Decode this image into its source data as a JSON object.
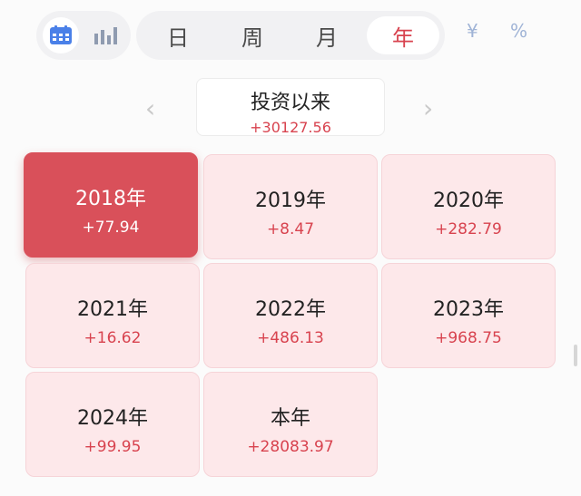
{
  "toolbar": {
    "views": [
      {
        "icon": "calendar-icon",
        "active": true
      },
      {
        "icon": "bar-chart-icon",
        "active": false
      }
    ],
    "periods": [
      "日",
      "周",
      "月",
      "年"
    ],
    "active_period": "年",
    "units": [
      "¥",
      "%"
    ],
    "colors": {
      "accent": "#d8434f",
      "icon_blue": "#4a80e8",
      "unit_blue": "#9fb3d6"
    }
  },
  "header": {
    "prev_arrow": "‹",
    "next_arrow": "›",
    "title": "投资以来",
    "value": "+30127.56"
  },
  "grid": {
    "cells": [
      {
        "label": "2018年",
        "value": "+77.94",
        "active": true
      },
      {
        "label": "2019年",
        "value": "+8.47",
        "active": false
      },
      {
        "label": "2020年",
        "value": "+282.79",
        "active": false
      },
      {
        "label": "2021年",
        "value": "+16.62",
        "active": false
      },
      {
        "label": "2022年",
        "value": "+486.13",
        "active": false
      },
      {
        "label": "2023年",
        "value": "+968.75",
        "active": false
      },
      {
        "label": "2024年",
        "value": "+99.95",
        "active": false
      },
      {
        "label": "本年",
        "value": "+28083.97",
        "active": false
      }
    ]
  }
}
